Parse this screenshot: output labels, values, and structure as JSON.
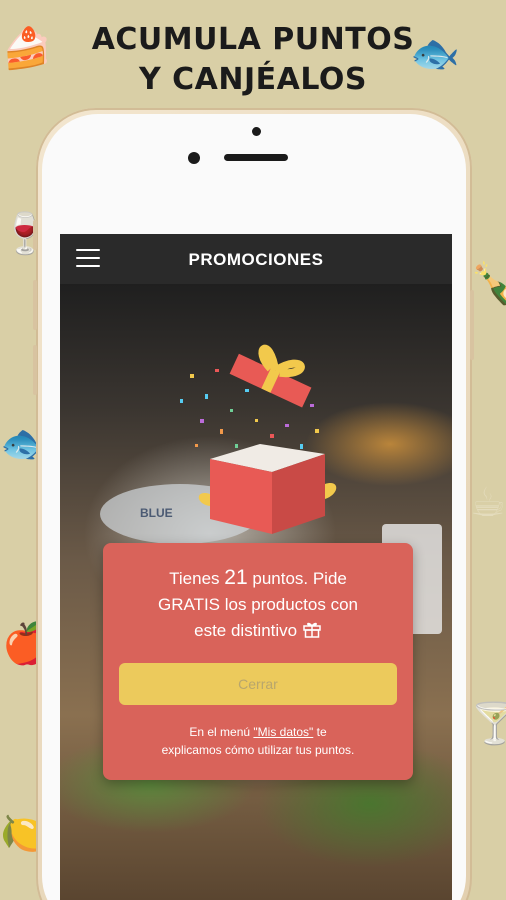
{
  "headline": {
    "line1": "ACUMULA PUNTOS",
    "line2": "Y CANJÉALOS"
  },
  "appbar": {
    "title": "PROMOCIONES",
    "menu_icon": "hamburger-menu-icon"
  },
  "modal": {
    "msg_prefix": "Tienes",
    "points": "21",
    "msg_line1_suffix": "puntos. Pide",
    "msg_line2": "GRATIS los productos con",
    "msg_line3": "este distintivo",
    "badge_icon": "gift-icon",
    "close_button": "Cerrar",
    "footer_prefix": "En el menú",
    "footer_link": "\"Mis datos\"",
    "footer_suffix": "te",
    "footer_line2": "explicamos cómo utilizar tus puntos."
  },
  "photo": {
    "plate_text": "BLUE"
  },
  "colors": {
    "background": "#d9cfa6",
    "appbar": "#2a2a2a",
    "modal": "#d9635a",
    "button": "#ecca5c"
  }
}
